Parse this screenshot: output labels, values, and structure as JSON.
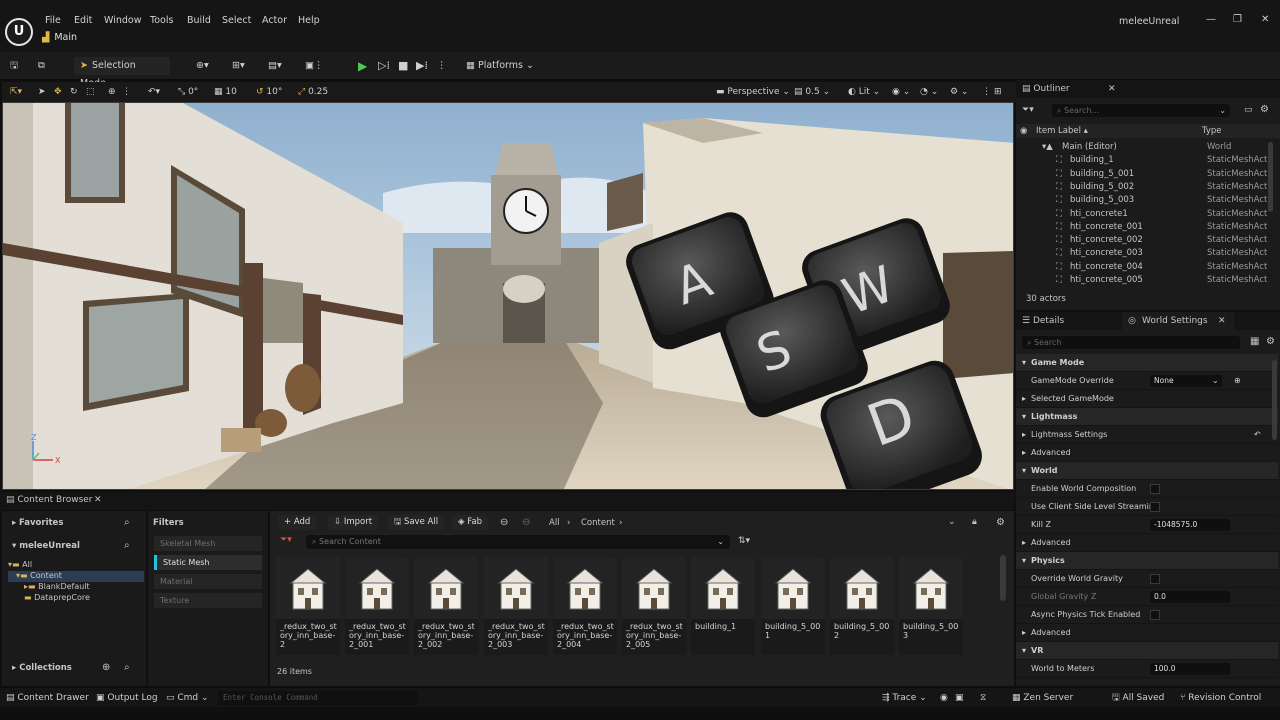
{
  "titlebar": {
    "menu": [
      "File",
      "Edit",
      "Window",
      "Tools",
      "Build",
      "Select",
      "Actor",
      "Help"
    ],
    "tab": "Main",
    "project_name": "meleeUnreal"
  },
  "toolbar": {
    "selection_mode": "Selection Mode",
    "platforms": "Platforms"
  },
  "viewport_toolbar": {
    "rotate_snap": "0°",
    "grid_snap": "10",
    "angle_snap": "10°",
    "scale_snap": "0.25",
    "view_mode": "Perspective",
    "camera_speed": "0.5",
    "lighting": "Lit"
  },
  "viewport": {
    "keys": [
      "A",
      "S",
      "W",
      "D"
    ],
    "axis_z": "Z",
    "axis_x": "X"
  },
  "content_browser": {
    "tab": "Content Browser",
    "favorites": "Favorites",
    "project": "meleeUnreal",
    "tree": [
      "All",
      "Content",
      "BlankDefault",
      "DataprepCore"
    ],
    "collections": "Collections",
    "filters_title": "Filters",
    "filters": [
      "Skeletal Mesh",
      "Static Mesh",
      "Material",
      "Texture"
    ],
    "add": "Add",
    "import": "Import",
    "save_all": "Save All",
    "fab": "Fab",
    "path_all": "All",
    "path_content": "Content",
    "search_placeholder": "Search Content",
    "item_count": "26 items",
    "assets": [
      "_redux_two_story_inn_base-2",
      "_redux_two_story_inn_base-2_001",
      "_redux_two_story_inn_base-2_002",
      "_redux_two_story_inn_base-2_003",
      "_redux_two_story_inn_base-2_004",
      "_redux_two_story_inn_base-2_005",
      "building_1",
      "building_5_001",
      "building_5_002",
      "building_5_003"
    ]
  },
  "statusbar": {
    "content_drawer": "Content Drawer",
    "output_log": "Output Log",
    "cmd": "Cmd",
    "console_placeholder": "Enter Console Command",
    "trace": "Trace",
    "zen_server": "Zen Server",
    "all_saved": "All Saved",
    "revision_control": "Revision Control"
  },
  "outliner": {
    "tab": "Outliner",
    "search_placeholder": "Search...",
    "col_label": "Item Label",
    "col_type": "Type",
    "rows": [
      {
        "label": "Main (Editor)",
        "type": "World"
      },
      {
        "label": "building_1",
        "type": "StaticMeshActor"
      },
      {
        "label": "building_5_001",
        "type": "StaticMeshActor"
      },
      {
        "label": "building_5_002",
        "type": "StaticMeshActor"
      },
      {
        "label": "building_5_003",
        "type": "StaticMeshActor"
      },
      {
        "label": "hti_concrete1",
        "type": "StaticMeshActor"
      },
      {
        "label": "hti_concrete_001",
        "type": "StaticMeshActor"
      },
      {
        "label": "hti_concrete_002",
        "type": "StaticMeshActor"
      },
      {
        "label": "hti_concrete_003",
        "type": "StaticMeshActor"
      },
      {
        "label": "hti_concrete_004",
        "type": "StaticMeshActor"
      },
      {
        "label": "hti_concrete_005",
        "type": "StaticMeshActor"
      }
    ],
    "actor_count": "30 actors"
  },
  "details": {
    "tab_details": "Details",
    "tab_world": "World Settings",
    "search_placeholder": "Search",
    "rows": [
      {
        "label": "Game Mode",
        "kind": "section"
      },
      {
        "label": "GameMode Override",
        "kind": "select",
        "value": "None"
      },
      {
        "label": "Selected GameMode",
        "kind": "sub"
      },
      {
        "label": "Lightmass",
        "kind": "section"
      },
      {
        "label": "Lightmass Settings",
        "kind": "sub"
      },
      {
        "label": "Advanced",
        "kind": "sub"
      },
      {
        "label": "World",
        "kind": "section"
      },
      {
        "label": "Enable World Composition",
        "kind": "check"
      },
      {
        "label": "Use Client Side Level Streamin...",
        "kind": "check"
      },
      {
        "label": "Kill Z",
        "kind": "input",
        "value": "-1048575.0"
      },
      {
        "label": "Advanced",
        "kind": "sub"
      },
      {
        "label": "Physics",
        "kind": "section"
      },
      {
        "label": "Override World Gravity",
        "kind": "check"
      },
      {
        "label": "Global Gravity Z",
        "kind": "input",
        "value": "0.0"
      },
      {
        "label": "Async Physics Tick Enabled",
        "kind": "check"
      },
      {
        "label": "Advanced",
        "kind": "sub"
      },
      {
        "label": "VR",
        "kind": "section"
      },
      {
        "label": "World to Meters",
        "kind": "input",
        "value": "100.0"
      }
    ]
  }
}
